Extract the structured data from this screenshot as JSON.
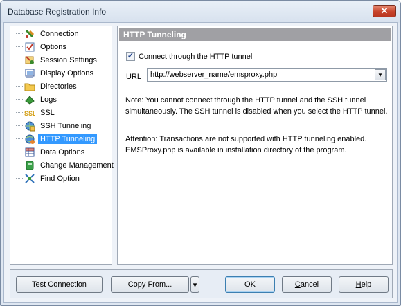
{
  "window": {
    "title": "Database Registration Info",
    "close_glyph": "✕"
  },
  "tree": {
    "items": [
      {
        "label": "Connection",
        "icon": "connection-icon"
      },
      {
        "label": "Options",
        "icon": "options-icon"
      },
      {
        "label": "Session Settings",
        "icon": "session-settings-icon"
      },
      {
        "label": "Display Options",
        "icon": "display-options-icon"
      },
      {
        "label": "Directories",
        "icon": "folder-icon"
      },
      {
        "label": "Logs",
        "icon": "logs-icon"
      },
      {
        "label": "SSL",
        "icon": "ssl-icon"
      },
      {
        "label": "SSH Tunneling",
        "icon": "ssh-icon"
      },
      {
        "label": "HTTP Tunneling",
        "icon": "http-globe-icon",
        "selected": true
      },
      {
        "label": "Data Options",
        "icon": "data-options-icon"
      },
      {
        "label": "Change Management",
        "icon": "change-management-icon"
      },
      {
        "label": "Find Option",
        "icon": "find-option-icon"
      }
    ]
  },
  "panel": {
    "header": "HTTP Tunneling",
    "checkbox_label": "Connect through the HTTP tunnel",
    "checkbox_checked": true,
    "url_label_underlined": "U",
    "url_label_rest": "RL",
    "url_value": "http://webserver_name/emsproxy.php",
    "note": "Note: You cannot connect through the HTTP tunnel and the SSH tunnel simultaneously. The SSH tunnel is disabled  when you select the HTTP tunnel.",
    "attention": "Attention: Transactions are not supported with HTTP tunneling enabled. EMSProxy.php is available in installation directory of the program."
  },
  "buttons": {
    "test_connection": "Test Connection",
    "copy_from": "Copy From...",
    "copy_from_arrow": "▾",
    "ok": "OK",
    "cancel_underlined": "C",
    "cancel_rest": "ancel",
    "help_underlined": "H",
    "help_rest": "elp"
  }
}
